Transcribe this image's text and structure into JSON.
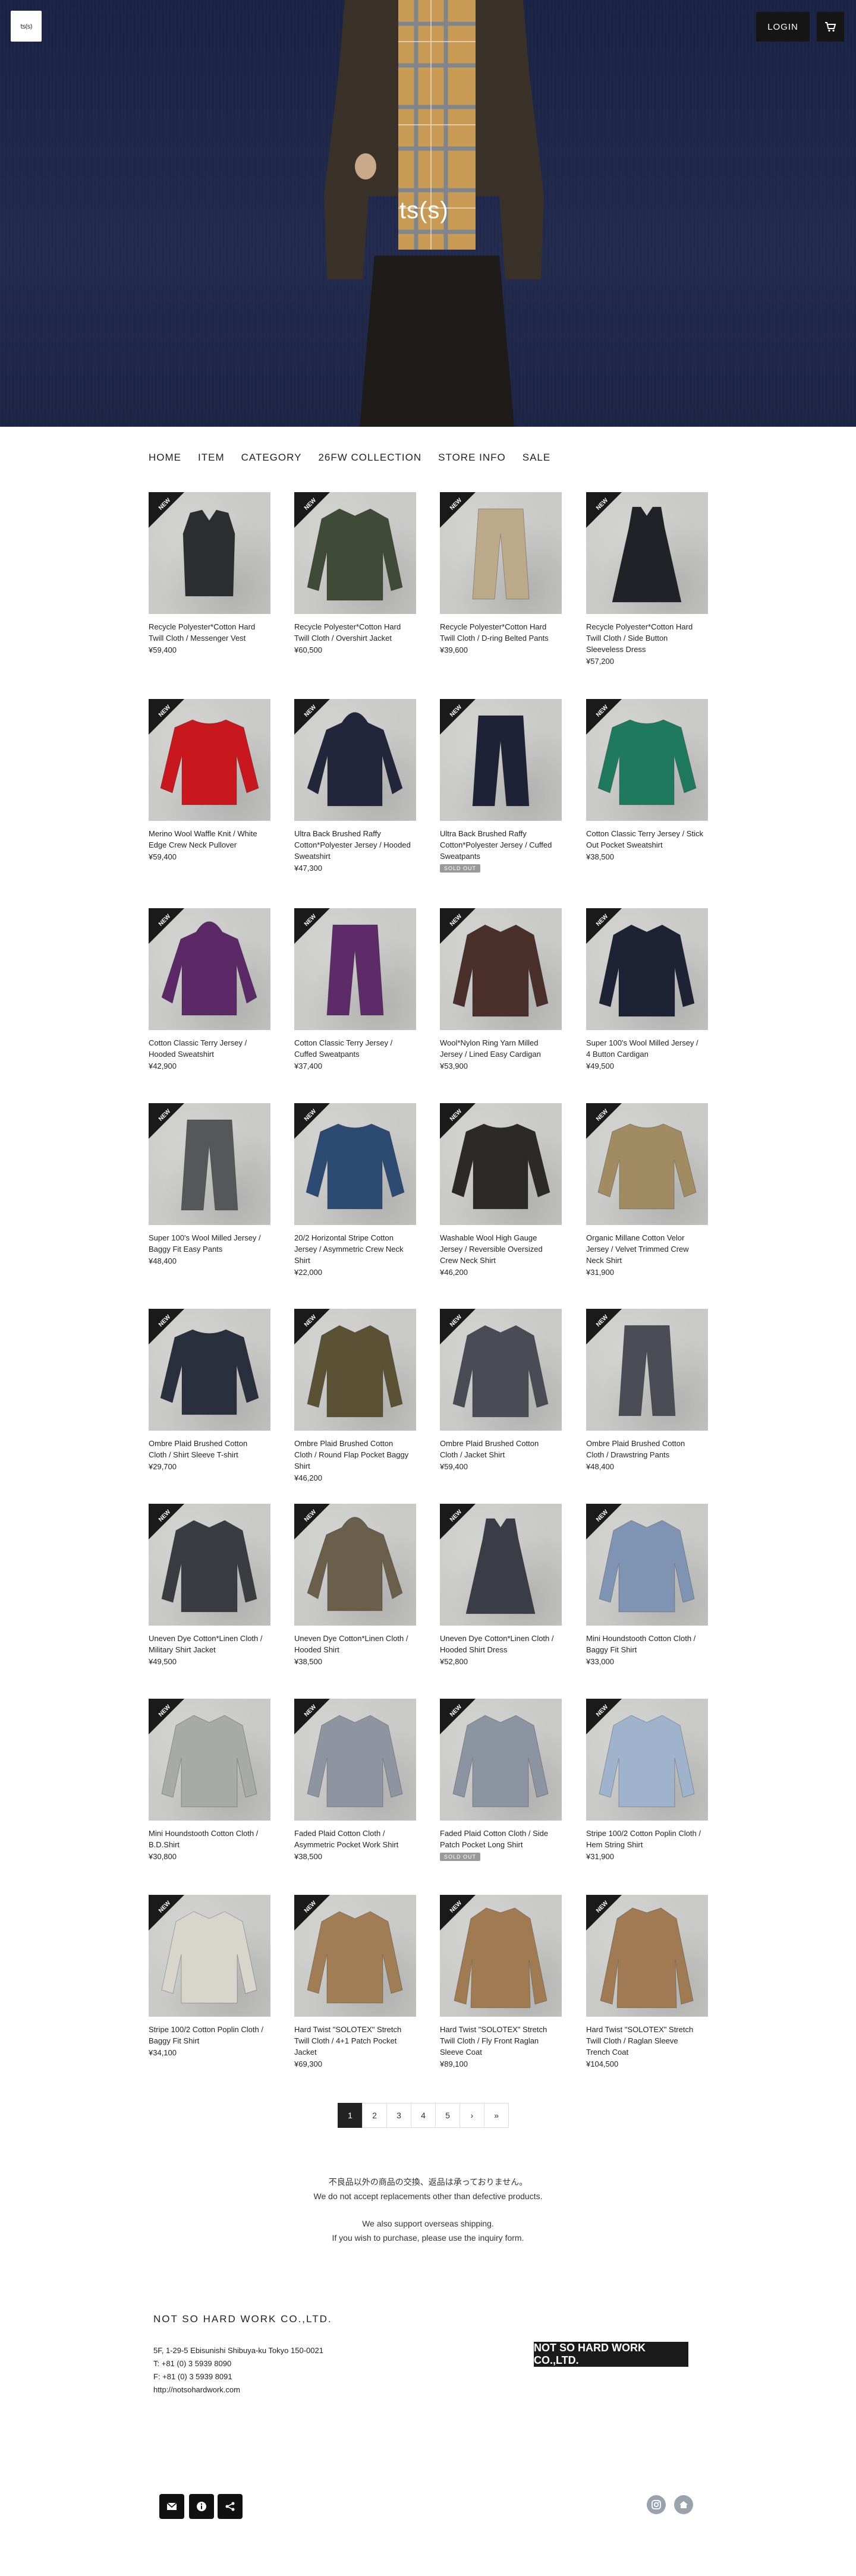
{
  "header": {
    "brand": "ts(s)",
    "logo_text": "ts(s)",
    "login_label": "LOGIN"
  },
  "nav": [
    "HOME",
    "ITEM",
    "CATEGORY",
    "26FW COLLECTION",
    "STORE INFO",
    "SALE"
  ],
  "badge_text": "NEW",
  "sold_out_label": "SOLD OUT",
  "products": [
    {
      "name": "Recycle Polyester*Cotton Hard Twill Cloth / Messenger Vest",
      "price": "¥59,400",
      "color": "#2b2d31",
      "shape": "vest"
    },
    {
      "name": "Recycle Polyester*Cotton Hard Twill Cloth / Overshirt Jacket",
      "price": "¥60,500",
      "color": "#3f4a37",
      "shape": "jacket"
    },
    {
      "name": "Recycle Polyester*Cotton Hard Twill Cloth / D-ring Belted Pants",
      "price": "¥39,600",
      "color": "#bba98a",
      "shape": "pants"
    },
    {
      "name": "Recycle Polyester*Cotton Hard Twill Cloth / Side Button Sleeveless Dress",
      "price": "¥57,200",
      "color": "#202227",
      "shape": "dress"
    },
    {
      "name": "Merino Wool Waffle Knit / White Edge Crew Neck Pullover",
      "price": "¥59,400",
      "color": "#c8171d",
      "shape": "sweater"
    },
    {
      "name": "Ultra Back Brushed Raffy Cotton*Polyester Jersey / Hooded Sweatshirt",
      "price": "¥47,300",
      "color": "#23263a",
      "shape": "hoodie"
    },
    {
      "name": "Ultra Back Brushed Raffy Cotton*Polyester Jersey / Cuffed Sweatpants",
      "price": "",
      "color": "#1f2236",
      "shape": "pants",
      "sold_out": true
    },
    {
      "name": "Cotton Classic Terry Jersey / Stick Out Pocket Sweatshirt",
      "price": "¥38,500",
      "color": "#1f7a5d",
      "shape": "sweater"
    },
    {
      "name": "Cotton Classic Terry Jersey / Hooded Sweatshirt",
      "price": "¥42,900",
      "color": "#5b2a66",
      "shape": "hoodie"
    },
    {
      "name": "Cotton Classic Terry Jersey / Cuffed Sweatpants",
      "price": "¥37,400",
      "color": "#5c2b68",
      "shape": "pants"
    },
    {
      "name": "Wool*Nylon Ring Yarn Milled Jersey / Lined Easy Cardigan",
      "price": "¥53,900",
      "color": "#4a2f2a",
      "shape": "jacket"
    },
    {
      "name": "Super 100's Wool Milled Jersey / 4 Button Cardigan",
      "price": "¥49,500",
      "color": "#1d2335",
      "shape": "jacket"
    },
    {
      "name": "Super 100's Wool Milled Jersey / Baggy Fit Easy Pants",
      "price": "¥48,400",
      "color": "#55575b",
      "shape": "pants"
    },
    {
      "name": "20/2 Horizontal Stripe Cotton Jersey / Asymmetric Crew Neck Shirt",
      "price": "¥22,000",
      "color": "#2c4a72",
      "shape": "sweater"
    },
    {
      "name": "Washable Wool High Gauge Jersey / Reversible Oversized Crew Neck Shirt",
      "price": "¥46,200",
      "color": "#2c2a28",
      "shape": "sweater"
    },
    {
      "name": "Organic Millane Cotton Velor Jersey / Velvet Trimmed Crew Neck Shirt",
      "price": "¥31,900",
      "color": "#a08b63",
      "shape": "sweater"
    },
    {
      "name": "Ombre Plaid Brushed Cotton Cloth / Shirt Sleeve T-shirt",
      "price": "¥29,700",
      "color": "#2a2f3e",
      "shape": "sweater"
    },
    {
      "name": "Ombre Plaid Brushed Cotton Cloth / Round Flap Pocket Baggy Shirt",
      "price": "¥46,200",
      "color": "#5b5236",
      "shape": "jacket"
    },
    {
      "name": "Ombre Plaid Brushed Cotton Cloth / Jacket Shirt",
      "price": "¥59,400",
      "color": "#4a4b55",
      "shape": "jacket"
    },
    {
      "name": "Ombre Plaid Brushed Cotton Cloth / Drawstring Pants",
      "price": "¥48,400",
      "color": "#4b4c55",
      "shape": "pants"
    },
    {
      "name": "Uneven Dye Cotton*Linen Cloth / Military Shirt Jacket",
      "price": "¥49,500",
      "color": "#3a3c42",
      "shape": "jacket"
    },
    {
      "name": "Uneven Dye Cotton*Linen Cloth / Hooded Shirt",
      "price": "¥38,500",
      "color": "#6a5f4a",
      "shape": "hoodie"
    },
    {
      "name": "Uneven Dye Cotton*Linen Cloth / Hooded Shirt Dress",
      "price": "¥52,800",
      "color": "#3b3d46",
      "shape": "dress"
    },
    {
      "name": "Mini Houndstooth Cotton Cloth / Baggy Fit Shirt",
      "price": "¥33,000",
      "color": "#7f94b3",
      "shape": "jacket"
    },
    {
      "name": "Mini Houndstooth Cotton Cloth / B.D.Shirt",
      "price": "¥30,800",
      "color": "#a7aaa6",
      "shape": "jacket"
    },
    {
      "name": "Faded Plaid Cotton Cloth / Asymmetric Pocket Work Shirt",
      "price": "¥38,500",
      "color": "#8e94a0",
      "shape": "jacket"
    },
    {
      "name": "Faded Plaid Cotton Cloth / Side Patch Pocket Long Shirt",
      "price": "",
      "color": "#8c93a1",
      "shape": "jacket",
      "sold_out": true
    },
    {
      "name": "Stripe 100/2 Cotton Poplin Cloth / Hem String Shirt",
      "price": "¥31,900",
      "color": "#9fb3cc",
      "shape": "jacket"
    },
    {
      "name": "Stripe 100/2 Cotton Poplin Cloth / Baggy Fit Shirt",
      "price": "¥34,100",
      "color": "#d8d6cc",
      "shape": "jacket"
    },
    {
      "name": "Hard Twist \"SOLOTEX\" Stretch Twill Cloth / 4+1 Patch Pocket Jacket",
      "price": "¥69,300",
      "color": "#a07d54",
      "shape": "jacket"
    },
    {
      "name": "Hard Twist \"SOLOTEX\" Stretch Twill Cloth / Fly Front Raglan Sleeve Coat",
      "price": "¥89,100",
      "color": "#a07b52",
      "shape": "coat"
    },
    {
      "name": "Hard Twist \"SOLOTEX\" Stretch Twill Cloth / Raglan Sleeve Trench Coat",
      "price": "¥104,500",
      "color": "#9f7a52",
      "shape": "coat"
    }
  ],
  "pagination": [
    "1",
    "2",
    "3",
    "4",
    "5",
    "›",
    "»"
  ],
  "notice": {
    "line1": "不良品以外の商品の交換、返品は承っておりません。",
    "line2": "We do not accept replacements other than defective products.",
    "line3": "We also support overseas shipping.",
    "line4": "If you wish to purchase, please use the inquiry form."
  },
  "footer": {
    "company": "NOT SO HARD WORK CO.,LTD.",
    "address": "5F, 1-29-5 Ebisunishi Shibuya-ku Tokyo 150-0021",
    "tel": "T: +81 (0) 3 5939 8090",
    "fax": "F: +81 (0) 3 5939 8091",
    "url": "http://notsohardwork.com",
    "logo_text": "NOT SO HARD WORK CO.,LTD."
  },
  "icons": {
    "mail": "mail-icon",
    "info": "info-icon",
    "share": "share-icon",
    "instagram": "instagram-icon",
    "home": "home-icon",
    "cart": "cart-icon"
  }
}
